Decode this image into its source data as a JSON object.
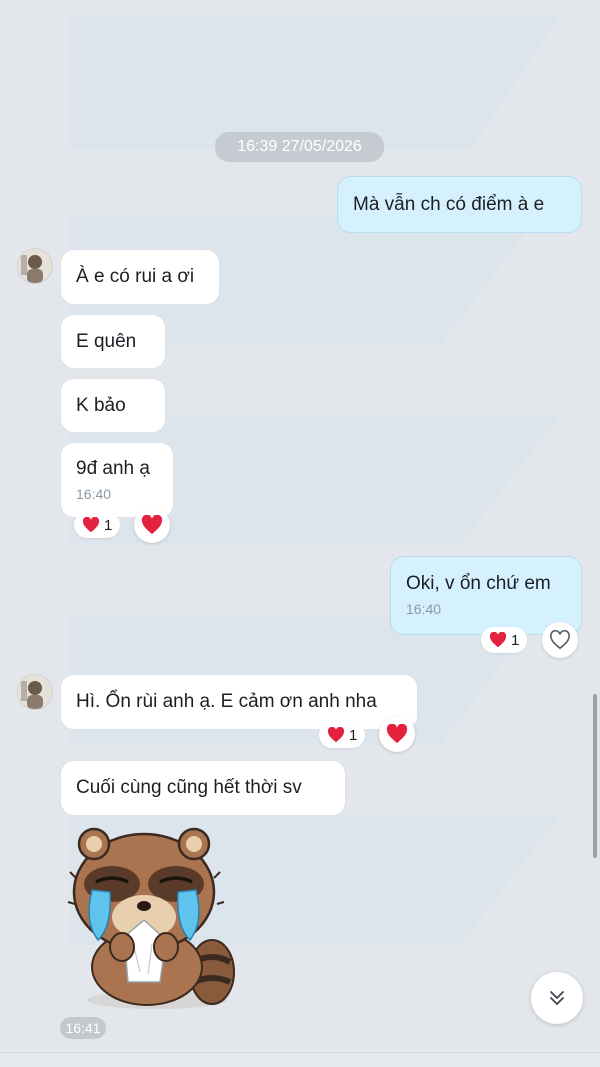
{
  "timestamp_header": "16:39 27/05/2026",
  "messages": [
    {
      "text": "Mà vẫn ch có điểm à e"
    },
    {
      "text": "À e có rui a ơi"
    },
    {
      "text": "E quên"
    },
    {
      "text": "K bảo"
    },
    {
      "text": "9đ anh ạ",
      "time": "16:40",
      "reaction_count": "1"
    },
    {
      "text": "Oki, v ổn chứ em",
      "time": "16:40",
      "reaction_count": "1"
    },
    {
      "text": "Hì. Ổn rùi anh ạ. E cảm ơn anh nha",
      "reaction_count": "1"
    },
    {
      "text": "Cuối cùng cũng hết thời sv"
    }
  ],
  "sticker": {
    "icon": "crying-raccoon-sticker",
    "time": "16:41"
  },
  "icons": {
    "heart": "heart-icon",
    "heart_outline": "heart-outline-icon",
    "scroll_down": "double-chevron-down-icon"
  },
  "colors": {
    "background": "#e3e7ec",
    "incoming_bubble": "#ffffff",
    "outgoing_bubble": "#d5f1fd",
    "heart": "#e5223d"
  }
}
